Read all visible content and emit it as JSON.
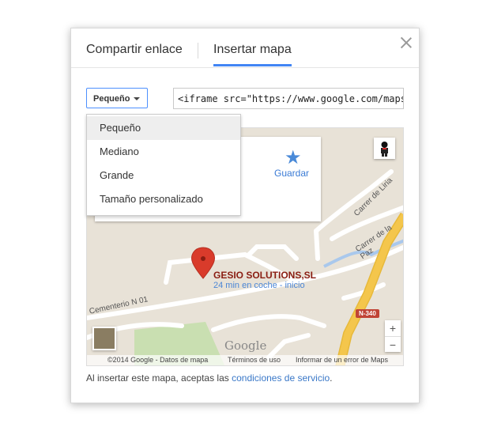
{
  "tabs": [
    {
      "label": "Compartir enlace",
      "active": false
    },
    {
      "label": "Insertar mapa",
      "active": true
    }
  ],
  "size_select": {
    "value": "Pequeño"
  },
  "embed_code": "<iframe src=\"https://www.google.com/maps/em",
  "dropdown": {
    "options": [
      "Pequeño",
      "Mediano",
      "Grande",
      "Tamaño personalizado"
    ],
    "selected": "Pequeño"
  },
  "map": {
    "save_label": "Guardar",
    "business_name": "GESIO SOLUTIONS,SL",
    "drive_time": "24 min en coche - inicio",
    "roads": {
      "cementerio": "Cementerio N 01",
      "liria": "Carrer de Liria",
      "paz": "Carrer de la Paz",
      "n340": "N-340"
    },
    "logo": "Google",
    "attribution": {
      "copyright": "©2014 Google - Datos de mapa",
      "terms": "Términos de uso",
      "report": "Informar de un error de Maps"
    },
    "zoom_in": "+",
    "zoom_out": "−",
    "colors": {
      "land": "#e8e2d7",
      "road": "#ffffff",
      "highway": "#f4c64c",
      "park": "#c9dfb1",
      "water": "#a9c8ec",
      "pin": "#d93b2b"
    }
  },
  "footer": {
    "text": "Al insertar este mapa, aceptas las ",
    "link": "condiciones de servicio",
    "end": "."
  },
  "colors": {
    "accent": "#4285f4",
    "link": "#3a78c8"
  }
}
